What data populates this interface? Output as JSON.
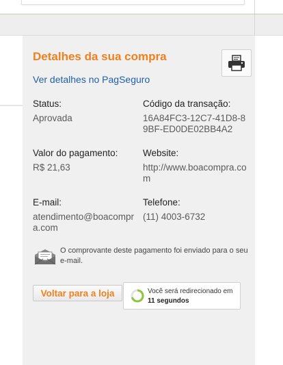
{
  "details": {
    "title": "Detalhes da sua compra",
    "pagseguro_link": "Ver detalhes no PagSeguro",
    "status_label": "Status:",
    "status_value": "Aprovada",
    "transaction_label": "Código da transação:",
    "transaction_value": "16A84FC3-12C7-41D8-89BF-ED0DE02BB4A2",
    "amount_label": "Valor do pagamento:",
    "amount_value": "R$ 21,63",
    "website_label": "Website:",
    "website_value": "http://www.boacompra.com",
    "email_label": "E-mail:",
    "email_value": "atendimento@boacompra.com",
    "phone_label": "Telefone:",
    "phone_value": "(11) 4003-6732"
  },
  "notice": {
    "text": "O comprovante deste pagamento foi enviado para o seu e-mail."
  },
  "actions": {
    "back_label": "Voltar para a loja",
    "redirect_prefix": "Você será redirecionado em",
    "redirect_seconds": "11 segundos",
    "redirect_progress": 0.7
  },
  "icons": {
    "print": "printer-icon",
    "notice": "envelope-icon",
    "redirect": "spinner-icon"
  },
  "colors": {
    "accent": "#f0801e",
    "link": "#1f5fa8",
    "panel_bg": "#f0f0f0",
    "spinner": "#8cc63f"
  }
}
